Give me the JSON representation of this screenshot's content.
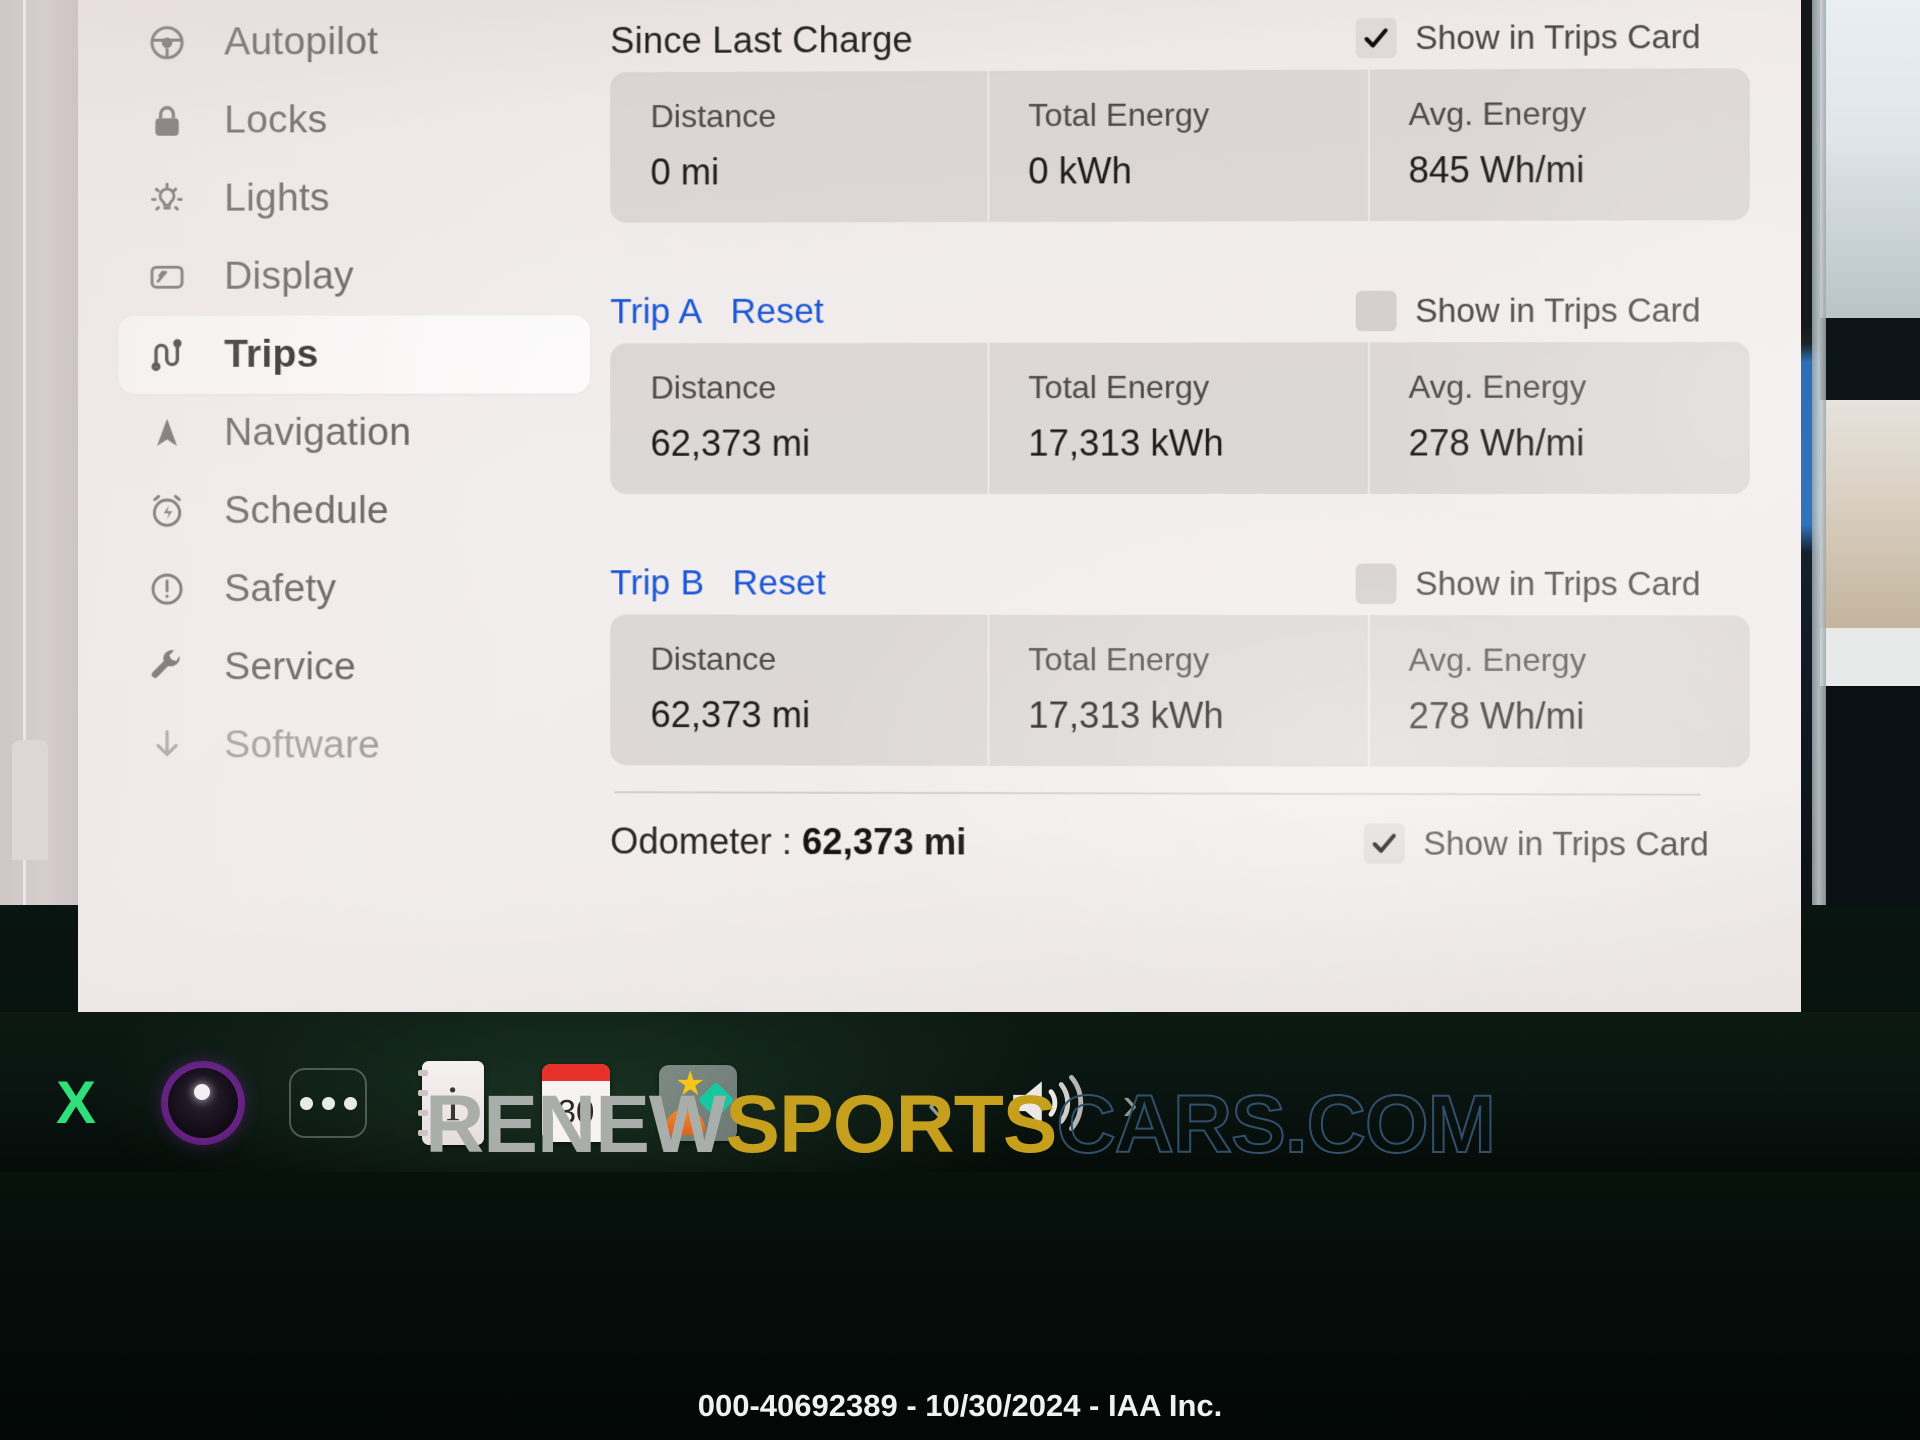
{
  "sidebar": {
    "items": [
      {
        "label": "Autopilot",
        "icon": "steering-wheel-icon",
        "active": false
      },
      {
        "label": "Locks",
        "icon": "lock-icon",
        "active": false
      },
      {
        "label": "Lights",
        "icon": "light-bulb-icon",
        "active": false
      },
      {
        "label": "Display",
        "icon": "display-icon",
        "active": false
      },
      {
        "label": "Trips",
        "icon": "trips-route-icon",
        "active": true
      },
      {
        "label": "Navigation",
        "icon": "navigation-arrow-icon",
        "active": false
      },
      {
        "label": "Schedule",
        "icon": "alarm-clock-icon",
        "active": false
      },
      {
        "label": "Safety",
        "icon": "exclamation-circle-icon",
        "active": false
      },
      {
        "label": "Service",
        "icon": "wrench-icon",
        "active": false
      },
      {
        "label": "Software",
        "icon": "download-arrow-icon",
        "active": false
      }
    ]
  },
  "content": {
    "columns": [
      "Distance",
      "Total Energy",
      "Avg. Energy"
    ],
    "checkbox_label": "Show in Trips Card",
    "sections": [
      {
        "title": "Since Last Charge",
        "type": "static",
        "show_in_trips_card": true,
        "values": [
          "0 mi",
          "0 kWh",
          "845 Wh/mi"
        ]
      },
      {
        "title": "Trip A",
        "type": "trip",
        "reset_label": "Reset",
        "show_in_trips_card": false,
        "values": [
          "62,373 mi",
          "17,313 kWh",
          "278 Wh/mi"
        ]
      },
      {
        "title": "Trip B",
        "type": "trip",
        "reset_label": "Reset",
        "show_in_trips_card": false,
        "values": [
          "62,373 mi",
          "17,313 kWh",
          "278 Wh/mi"
        ]
      }
    ],
    "odometer": {
      "label": "Odometer :",
      "value": "62,373 mi",
      "show_in_trips_card": true,
      "checkbox_label": "Show in Trips Card"
    }
  },
  "taskbar": {
    "icons": [
      {
        "name": "bluetooth-icon",
        "glyph": "X"
      },
      {
        "name": "media-orb-icon"
      },
      {
        "name": "more-dots-icon"
      },
      {
        "name": "info-notes-icon",
        "glyph": "i"
      },
      {
        "name": "calendar-icon",
        "day": "30"
      },
      {
        "name": "gallery-icon"
      }
    ],
    "prev_label": "‹",
    "next_label": "›",
    "volume_icon": "speaker-volume-icon"
  },
  "watermark": {
    "part1": "RENEW",
    "part2": "SPORTS",
    "part3": "CARS.COM",
    "subtitle": "000-40692389 - 10/30/2024 - IAA Inc."
  },
  "colors": {
    "link": "#1b56d8",
    "accent_green": "#2fe07a",
    "calendar_red": "#e8302a",
    "panel_bg": "#f2eded"
  }
}
